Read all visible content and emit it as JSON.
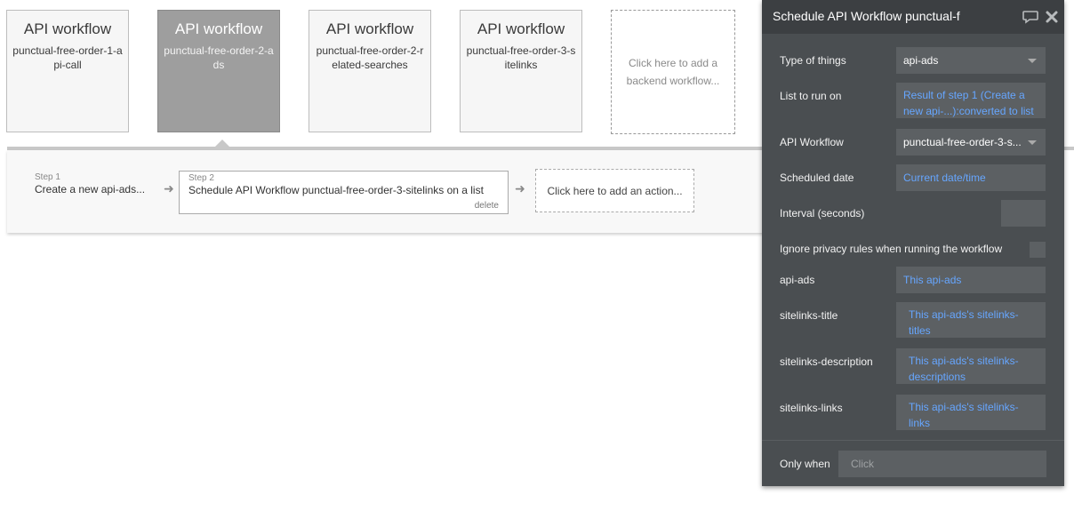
{
  "workflows": [
    {
      "title": "API workflow",
      "name": "punctual-free-order-1-api-call"
    },
    {
      "title": "API workflow",
      "name": "punctual-free-order-2-ads"
    },
    {
      "title": "API workflow",
      "name": "punctual-free-order-2-related-searches"
    },
    {
      "title": "API workflow",
      "name": "punctual-free-order-3-sitelinks"
    }
  ],
  "add_workflow_label": "Click here to add a backend workflow...",
  "steps": {
    "step1": {
      "num": "Step 1",
      "label": "Create a new api-ads..."
    },
    "step2": {
      "num": "Step 2",
      "label": "Schedule API Workflow punctual-free-order-3-sitelinks on a list",
      "delete": "delete"
    },
    "add_action": "Click here to add an action..."
  },
  "panel": {
    "title": "Schedule API Workflow punctual-f",
    "icons": {
      "comment": "comment-icon",
      "close": "close-icon"
    },
    "type_of_things": {
      "label": "Type of things",
      "value": "api-ads"
    },
    "list_to_run_on": {
      "label": "List to run on",
      "value": "Result of step 1 (Create a new api-...):converted to list"
    },
    "api_workflow": {
      "label": "API Workflow",
      "value": "punctual-free-order-3-s..."
    },
    "scheduled_date": {
      "label": "Scheduled date",
      "value": "Current date/time"
    },
    "interval": {
      "label": "Interval (seconds)",
      "value": ""
    },
    "ignore_privacy": {
      "label": "Ignore privacy rules when running the workflow",
      "checked": false
    },
    "api_ads": {
      "label": "api-ads",
      "value": "This api-ads"
    },
    "sitelinks_title": {
      "label": "sitelinks-title",
      "value": "This api-ads's sitelinks-titles"
    },
    "sitelinks_description": {
      "label": "sitelinks-description",
      "value": "This api-ads's sitelinks-descriptions"
    },
    "sitelinks_links": {
      "label": "sitelinks-links",
      "value": "This api-ads's sitelinks-links"
    },
    "only_when": {
      "label": "Only when",
      "placeholder": "Click"
    }
  }
}
